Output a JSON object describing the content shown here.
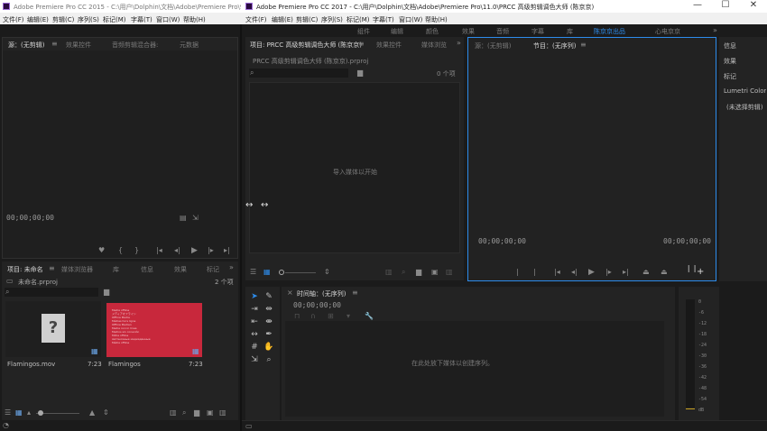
{
  "window_left": {
    "title": "Adobe Premiere Pro CC 2015 - C:\\用户\\Dolphin\\文档\\Adobe\\Premiere Pro\\9.0\\",
    "menu": [
      "文件(F)",
      "编辑(E)",
      "剪辑(C)",
      "序列(S)",
      "标记(M)",
      "字幕(T)",
      "窗口(W)",
      "帮助(H)"
    ],
    "source_tabs": [
      "源：(无剪辑)",
      "效果控件",
      "音频剪辑混合器:",
      "元数据"
    ],
    "timecode": "00;00;00;00",
    "project_tabs": [
      "项目: 未命名",
      "媒体浏览器",
      "库",
      "信息",
      "效果",
      "标记"
    ],
    "project_file": "未命名.prproj",
    "item_count": "2 个项",
    "clips": [
      {
        "name": "Flamingos.mov",
        "duration": "7:23"
      },
      {
        "name": "Flamingos",
        "duration": "7:23"
      }
    ],
    "thumb_text": [
      "Media offline",
      "メディアオフライン",
      "Offline Media",
      "Médias hors ligne",
      "Offline Medien",
      "Media non in linea",
      "Medios sin conexión",
      "Mídia offline",
      "Автономные медиаданные",
      "Média offline"
    ]
  },
  "window_right": {
    "title": "Adobe Premiere Pro CC 2017 - C:\\用户\\Dolphin\\文档\\Adobe\\Premiere Pro\\11.0\\PRCC 高级剪辑调色大师 (陈京京)",
    "menu": [
      "文件(F)",
      "编辑(E)",
      "剪辑(C)",
      "序列(S)",
      "标记(M)",
      "字幕(T)",
      "窗口(W)",
      "帮助(H)"
    ],
    "workspaces": [
      "组件",
      "编辑",
      "颜色",
      "效果",
      "音频",
      "字幕",
      "库",
      "陈京京出品",
      "心电京京"
    ],
    "project_tabs": [
      "项目: PRCC 高级剪辑调色大师 (陈京京)",
      "效果控件",
      "媒体浏览"
    ],
    "project_file": "PRCC 高级剪辑调色大师 (陈京京).prproj",
    "item_count": "0 个项",
    "import_hint": "导入媒体以开始",
    "monitor_tabs": [
      "源：(无剪辑)",
      "节目：(无序列)"
    ],
    "program_tc_left": "00;00;00;00",
    "program_tc_right": "00;00;00;00",
    "side_panels": [
      "信息",
      "效果",
      "标记",
      "Lumetri Color",
      "(未选择剪辑)"
    ],
    "timeline_tab": "时间轴：(无序列)",
    "timeline_tc": "00;00;00;00",
    "timeline_hint": "在此处放下媒体以创建序列。",
    "meter_labels": [
      "0",
      "-6",
      "-12",
      "-18",
      "-24",
      "-30",
      "-36",
      "-42",
      "-48",
      "-54",
      "dB"
    ]
  },
  "colors": {
    "accent_blue": "#2d8ceb",
    "thumb_red": "#c8283c"
  }
}
